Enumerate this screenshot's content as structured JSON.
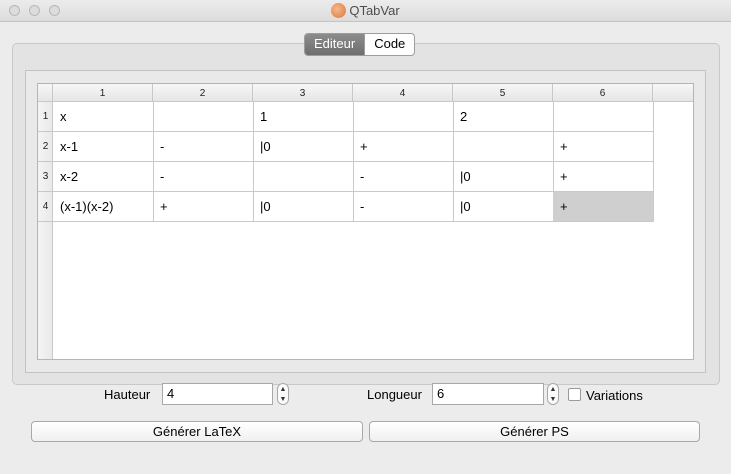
{
  "window": {
    "title": "QTabVar"
  },
  "tabs": [
    {
      "label": "Editeur",
      "active": true
    },
    {
      "label": "Code",
      "active": false
    }
  ],
  "table": {
    "column_headers": [
      "1",
      "2",
      "3",
      "4",
      "5",
      "6"
    ],
    "row_headers": [
      "1",
      "2",
      "3",
      "4"
    ],
    "rows": [
      [
        "x",
        "",
        "1",
        "",
        "2",
        ""
      ],
      [
        "x-1",
        "-",
        "|0",
        "+",
        "",
        "+"
      ],
      [
        "x-2",
        "-",
        "",
        "-",
        "|0",
        "+"
      ],
      [
        "(x-1)(x-2)",
        "+",
        "|0",
        "-",
        "|0",
        "+"
      ]
    ],
    "selected_cell": {
      "row": 4,
      "column": 6
    }
  },
  "controls": {
    "hauteur_label": "Hauteur",
    "hauteur_value": "4",
    "longueur_label": "Longueur",
    "longueur_value": "6",
    "variations_label": "Variations",
    "variations_checked": false,
    "generate_latex_label": "Générer LaTeX",
    "generate_ps_label": "Générer PS"
  },
  "colors": {
    "selected_cell": "#cfcfcf",
    "active_tab": "#7a7a7a"
  }
}
